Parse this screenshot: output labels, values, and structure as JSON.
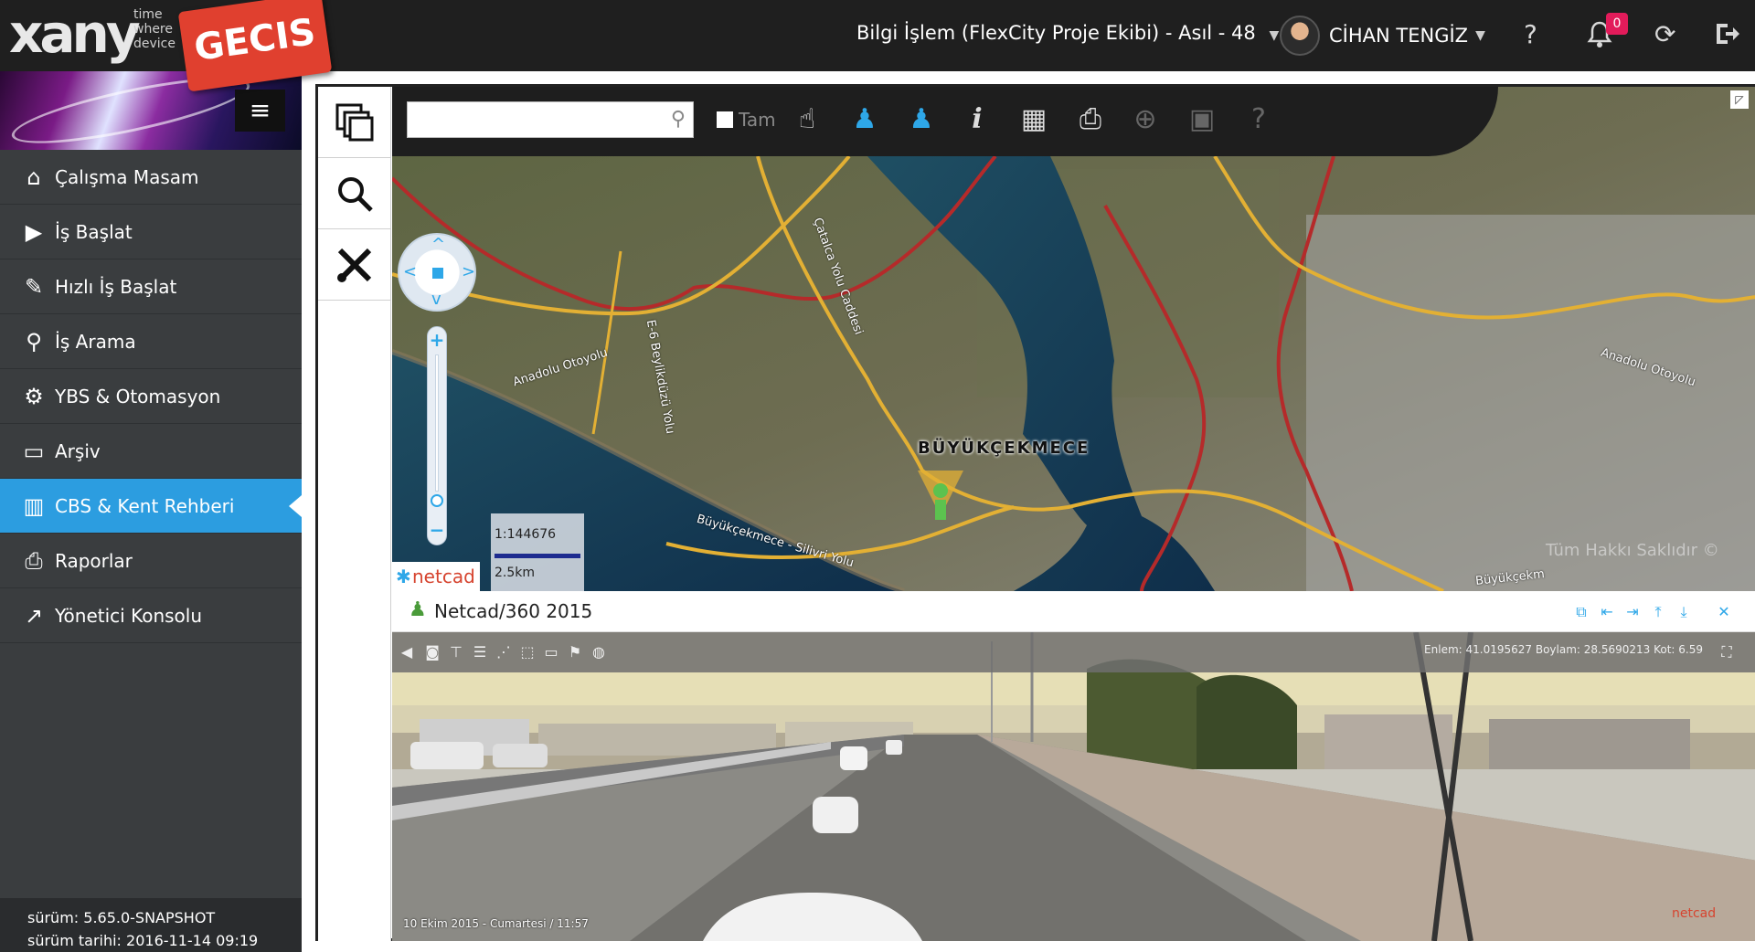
{
  "brand": {
    "logo": "xany",
    "tagline": [
      "time",
      "where",
      "device"
    ],
    "stamp": "GECIS"
  },
  "topbar": {
    "project": "Bilgi İşlem (FlexCity Proje Ekibi) - Asıl - 48",
    "user": "CİHAN TENGİZ",
    "notifications": "0",
    "icons": [
      "help-icon",
      "bell-icon",
      "refresh-icon",
      "logout-icon"
    ]
  },
  "sidebar": {
    "items": [
      {
        "label": "Çalışma Masam",
        "icon": "home-icon"
      },
      {
        "label": "İş Başlat",
        "icon": "play-circle-icon"
      },
      {
        "label": "Hızlı İş Başlat",
        "icon": "wrench-icon"
      },
      {
        "label": "İş Arama",
        "icon": "search-icon"
      },
      {
        "label": "YBS & Otomasyon",
        "icon": "gear-icon"
      },
      {
        "label": "Arşiv",
        "icon": "folder-open-icon"
      },
      {
        "label": "CBS & Kent Rehberi",
        "icon": "map-icon",
        "active": true
      },
      {
        "label": "Raporlar",
        "icon": "printer-icon"
      },
      {
        "label": "Yönetici Konsolu",
        "icon": "line-chart-icon"
      }
    ],
    "version": "sürüm: 5.65.0-SNAPSHOT",
    "version_date": "sürüm tarihi: 2016-11-14 09:19"
  },
  "map": {
    "search_placeholder": "",
    "tam_label": "Tam",
    "scale": "1:144676",
    "distance": "2.5km",
    "brand": "netcad",
    "place_label": "BÜYÜKÇEKMECE",
    "road_labels": [
      "Anadolu Otoyolu",
      "Çatalca Yolu Caddesi",
      "E-6 Beylikdüzü Yolu",
      "Anadolu Otoyolu",
      "Büyükçekmece - Silivri Yolu",
      "Büyükçekm"
    ],
    "copyright": "Tüm Hakkı Saklıdır ©",
    "tool_help": "?"
  },
  "pano": {
    "title": "Netcad/360 2015",
    "coords": "Enlem: 41.0195627  Boylam: 28.5690213  Kot: 6.59",
    "date": "10 Ekim 2015 - Cumartesi / 11:57",
    "brand": "netcad"
  }
}
